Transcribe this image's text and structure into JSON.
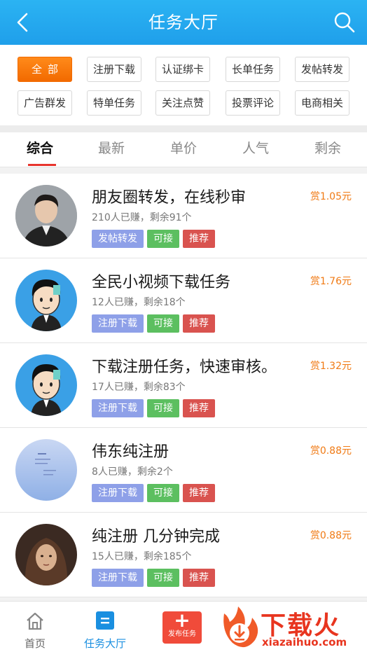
{
  "header": {
    "title": "任务大厅"
  },
  "filters": [
    "全部",
    "注册下载",
    "认证绑卡",
    "长单任务",
    "发帖转发",
    "广告群发",
    "特单任务",
    "关注点赞",
    "投票评论",
    "电商相关"
  ],
  "tabs": [
    "综合",
    "最新",
    "单价",
    "人气",
    "剩余"
  ],
  "tasks": [
    {
      "title": "朋友圈转发，在线秒审",
      "stats": "210人已赚，剩余91个",
      "reward": "赏1.05元",
      "tags": [
        "发帖转发",
        "可接",
        "推荐"
      ]
    },
    {
      "title": "全民小视频下载任务",
      "stats": "12人已赚，剩余18个",
      "reward": "赏1.76元",
      "tags": [
        "注册下载",
        "可接",
        "推荐"
      ]
    },
    {
      "title": "下载注册任务，快速审核。",
      "stats": "17人已赚，剩余83个",
      "reward": "赏1.32元",
      "tags": [
        "注册下载",
        "可接",
        "推荐"
      ]
    },
    {
      "title": "伟东纯注册",
      "stats": "8人已赚，剩余2个",
      "reward": "赏0.88元",
      "tags": [
        "注册下载",
        "可接",
        "推荐"
      ]
    },
    {
      "title": "纯注册 几分钟完成",
      "stats": "15人已赚，剩余185个",
      "reward": "赏0.88元",
      "tags": [
        "注册下载",
        "可接",
        "推荐"
      ]
    }
  ],
  "bottom_nav": {
    "home": "首页",
    "hall": "任务大厅",
    "publish": "发布任务"
  },
  "watermark": {
    "brand": "下载火",
    "url": "xiazaihuo.com"
  },
  "colors": {
    "header": "#1f9fea",
    "accent": "#f26a00",
    "reward": "#f07a14"
  }
}
